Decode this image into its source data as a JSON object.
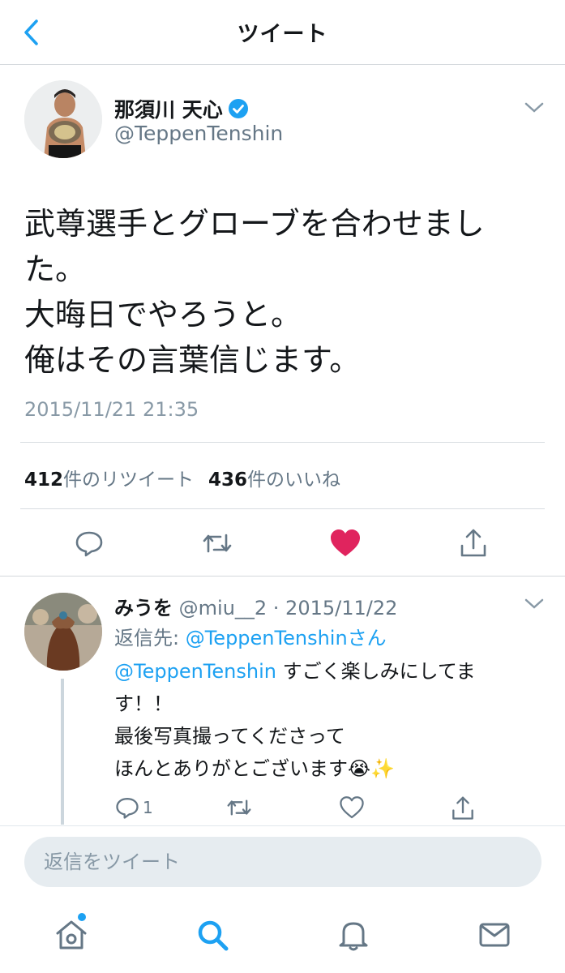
{
  "header": {
    "title": "ツイート"
  },
  "tweet": {
    "author_name": "那須川 天心",
    "handle": "@TeppenTenshin",
    "lines": [
      "武尊選手とグローブを合わせまし",
      "た。",
      "大晦日でやろうと。",
      "俺はその言葉信じます。"
    ],
    "timestamp": "2015/11/21 21:35",
    "retweet_count": "412",
    "retweet_label": "件のリツイート",
    "like_count": "436",
    "like_label": "件のいいね"
  },
  "reply": {
    "name": "みうを",
    "handle_date": "@miu__2 · 2015/11/22",
    "reply_to_label": "返信先: ",
    "reply_to_link": "@TeppenTenshinさん",
    "mention": "@TeppenTenshin",
    "line1_rest": " すごく楽しみにしてま",
    "lines": [
      "す！！",
      "最後写真撮ってくださって",
      "ほんとありがとございます😭✨"
    ],
    "reply_count": "1"
  },
  "reply_box": {
    "placeholder": "返信をツイート"
  },
  "colors": {
    "accent": "#1da1f2",
    "like": "#e0245e",
    "secondary": "#657786"
  },
  "icons": [
    "back-chevron-icon",
    "verified-icon",
    "caret-down-icon",
    "reply-icon",
    "retweet-icon",
    "heart-icon",
    "share-icon",
    "home-icon",
    "search-icon",
    "bell-icon",
    "mail-icon"
  ]
}
